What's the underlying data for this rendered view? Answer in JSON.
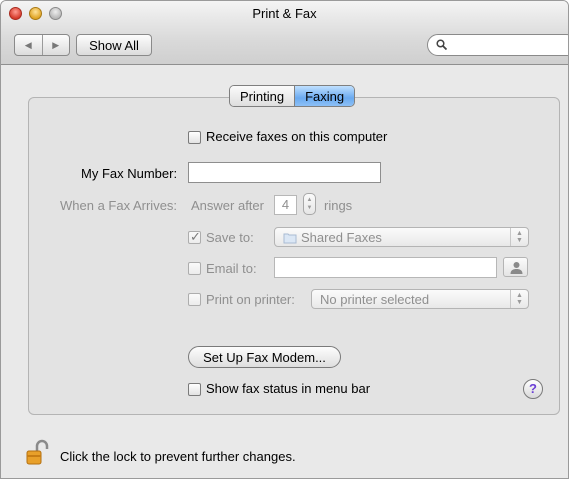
{
  "window": {
    "title": "Print & Fax"
  },
  "toolbar": {
    "show_all_label": "Show All",
    "back_icon": "◀",
    "forward_icon": "▶",
    "search_placeholder": ""
  },
  "tabs": [
    {
      "label": "Printing",
      "selected": false
    },
    {
      "label": "Faxing",
      "selected": true
    }
  ],
  "faxing": {
    "receive_faxes_label": "Receive faxes on this computer",
    "receive_faxes_checked": false,
    "my_fax_number_label": "My Fax Number:",
    "my_fax_number_value": "",
    "when_fax_arrives_label": "When a Fax Arrives:",
    "answer_after_label": "Answer after",
    "rings_value": "4",
    "rings_label": "rings",
    "save_to_label": "Save to:",
    "save_to_checked": true,
    "save_to_value": "Shared Faxes",
    "email_to_label": "Email to:",
    "email_to_checked": false,
    "email_to_value": "",
    "print_on_printer_label": "Print on printer:",
    "print_on_printer_checked": false,
    "print_on_printer_value": "No printer selected",
    "setup_fax_modem_label": "Set Up Fax Modem...",
    "show_fax_status_label": "Show fax status in menu bar",
    "show_fax_status_checked": false,
    "help_label": "?"
  },
  "footer": {
    "lock_text": "Click the lock to prevent further changes."
  },
  "colors": {
    "accent": "#6aaaf0",
    "disabled_text": "#8f8f8f"
  }
}
